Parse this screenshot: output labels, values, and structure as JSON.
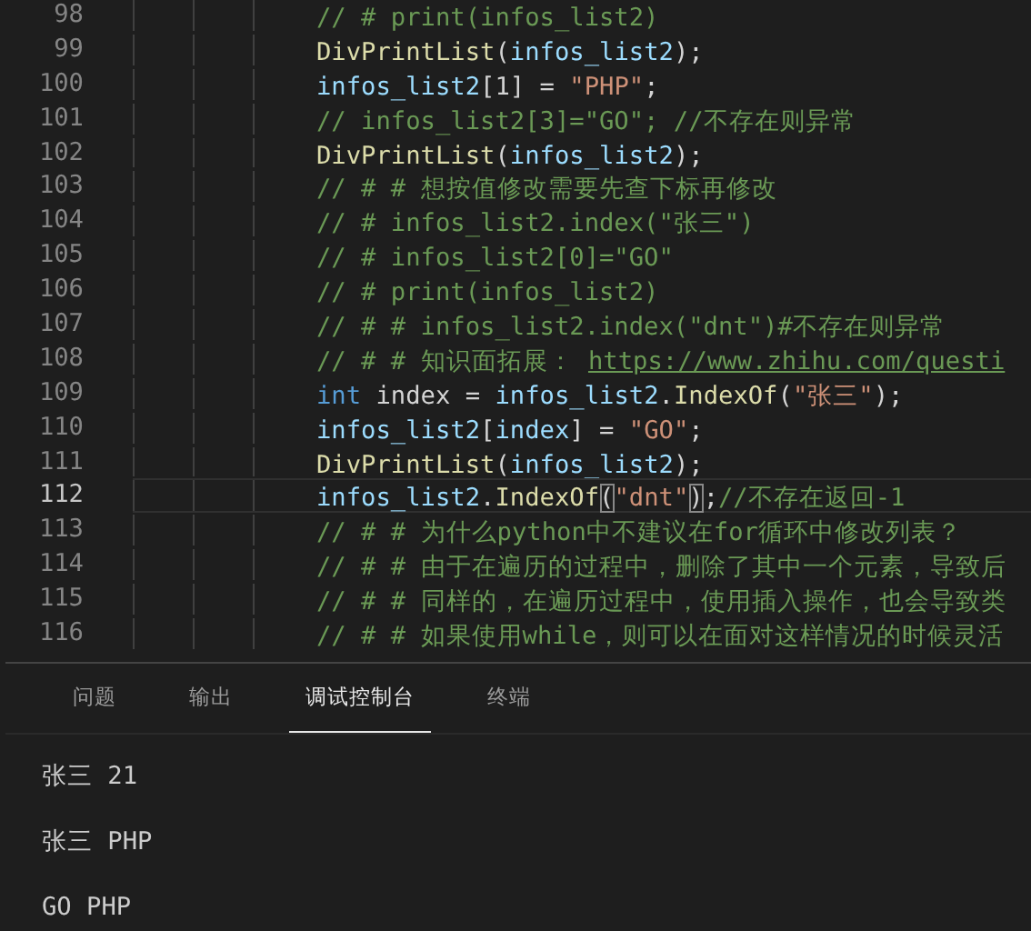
{
  "editor": {
    "lines": [
      {
        "number": "98",
        "current": false,
        "tokens": [
          {
            "kind": "comment",
            "text": "// # print(infos_list2)"
          }
        ]
      },
      {
        "number": "99",
        "current": false,
        "tokens": [
          {
            "kind": "fn",
            "text": "DivPrintList"
          },
          {
            "kind": "plain",
            "text": "("
          },
          {
            "kind": "var",
            "text": "infos_list2"
          },
          {
            "kind": "plain",
            "text": ");"
          }
        ]
      },
      {
        "number": "100",
        "current": false,
        "tokens": [
          {
            "kind": "var",
            "text": "infos_list2"
          },
          {
            "kind": "plain",
            "text": "[1] = "
          },
          {
            "kind": "str",
            "text": "\"PHP\""
          },
          {
            "kind": "plain",
            "text": ";"
          }
        ]
      },
      {
        "number": "101",
        "current": false,
        "tokens": [
          {
            "kind": "comment",
            "text": "// infos_list2[3]=\"GO\"; //不存在则异常"
          }
        ]
      },
      {
        "number": "102",
        "current": false,
        "tokens": [
          {
            "kind": "fn",
            "text": "DivPrintList"
          },
          {
            "kind": "plain",
            "text": "("
          },
          {
            "kind": "var",
            "text": "infos_list2"
          },
          {
            "kind": "plain",
            "text": ");"
          }
        ]
      },
      {
        "number": "103",
        "current": false,
        "tokens": [
          {
            "kind": "comment",
            "text": "// # # 想按值修改需要先查下标再修改"
          }
        ]
      },
      {
        "number": "104",
        "current": false,
        "tokens": [
          {
            "kind": "comment",
            "text": "// # infos_list2.index(\"张三\")"
          }
        ]
      },
      {
        "number": "105",
        "current": false,
        "tokens": [
          {
            "kind": "comment",
            "text": "// # infos_list2[0]=\"GO\""
          }
        ]
      },
      {
        "number": "106",
        "current": false,
        "tokens": [
          {
            "kind": "comment",
            "text": "// # print(infos_list2)"
          }
        ]
      },
      {
        "number": "107",
        "current": false,
        "tokens": [
          {
            "kind": "comment",
            "text": "// # # infos_list2.index(\"dnt\")#不存在则异常"
          }
        ]
      },
      {
        "number": "108",
        "current": false,
        "tokens": [
          {
            "kind": "comment",
            "text": "// # # 知识面拓展： "
          },
          {
            "kind": "link",
            "text": "https://www.zhihu.com/questi"
          }
        ]
      },
      {
        "number": "109",
        "current": false,
        "tokens": [
          {
            "kind": "kw",
            "text": "int"
          },
          {
            "kind": "plain",
            "text": " index = "
          },
          {
            "kind": "var",
            "text": "infos_list2"
          },
          {
            "kind": "plain",
            "text": "."
          },
          {
            "kind": "fn",
            "text": "IndexOf"
          },
          {
            "kind": "plain",
            "text": "("
          },
          {
            "kind": "str",
            "text": "\"张三\""
          },
          {
            "kind": "plain",
            "text": ");"
          }
        ]
      },
      {
        "number": "110",
        "current": false,
        "tokens": [
          {
            "kind": "var",
            "text": "infos_list2"
          },
          {
            "kind": "plain",
            "text": "["
          },
          {
            "kind": "var",
            "text": "index"
          },
          {
            "kind": "plain",
            "text": "] = "
          },
          {
            "kind": "str",
            "text": "\"GO\""
          },
          {
            "kind": "plain",
            "text": ";"
          }
        ]
      },
      {
        "number": "111",
        "current": false,
        "tokens": [
          {
            "kind": "fn",
            "text": "DivPrintList"
          },
          {
            "kind": "plain",
            "text": "("
          },
          {
            "kind": "var",
            "text": "infos_list2"
          },
          {
            "kind": "plain",
            "text": ");"
          }
        ]
      },
      {
        "number": "112",
        "current": true,
        "tokens": [
          {
            "kind": "var",
            "text": "infos_list2"
          },
          {
            "kind": "plain",
            "text": "."
          },
          {
            "kind": "fn",
            "text": "IndexOf"
          },
          {
            "kind": "bracket",
            "text": "("
          },
          {
            "kind": "str",
            "text": "\"dnt\""
          },
          {
            "kind": "bracket",
            "text": ")"
          },
          {
            "kind": "plain",
            "text": ";"
          },
          {
            "kind": "comment",
            "text": "//不存在返回-1"
          }
        ]
      },
      {
        "number": "113",
        "current": false,
        "tokens": [
          {
            "kind": "comment",
            "text": "// # # 为什么python中不建议在for循环中修改列表？"
          }
        ]
      },
      {
        "number": "114",
        "current": false,
        "tokens": [
          {
            "kind": "comment",
            "text": "// # # 由于在遍历的过程中，删除了其中一个元素，导致后"
          }
        ]
      },
      {
        "number": "115",
        "current": false,
        "tokens": [
          {
            "kind": "comment",
            "text": "// # # 同样的，在遍历过程中，使用插入操作，也会导致类"
          }
        ]
      },
      {
        "number": "116",
        "current": false,
        "tokens": [
          {
            "kind": "comment",
            "text": "// # # 如果使用while，则可以在面对这样情况的时候灵活"
          }
        ]
      }
    ]
  },
  "panel": {
    "tabs": [
      {
        "label": "问题",
        "selected": false
      },
      {
        "label": "输出",
        "selected": false
      },
      {
        "label": "调试控制台",
        "selected": true
      },
      {
        "label": "终端",
        "selected": false
      }
    ],
    "output": [
      "张三 21",
      "张三 PHP",
      "GO PHP"
    ]
  }
}
